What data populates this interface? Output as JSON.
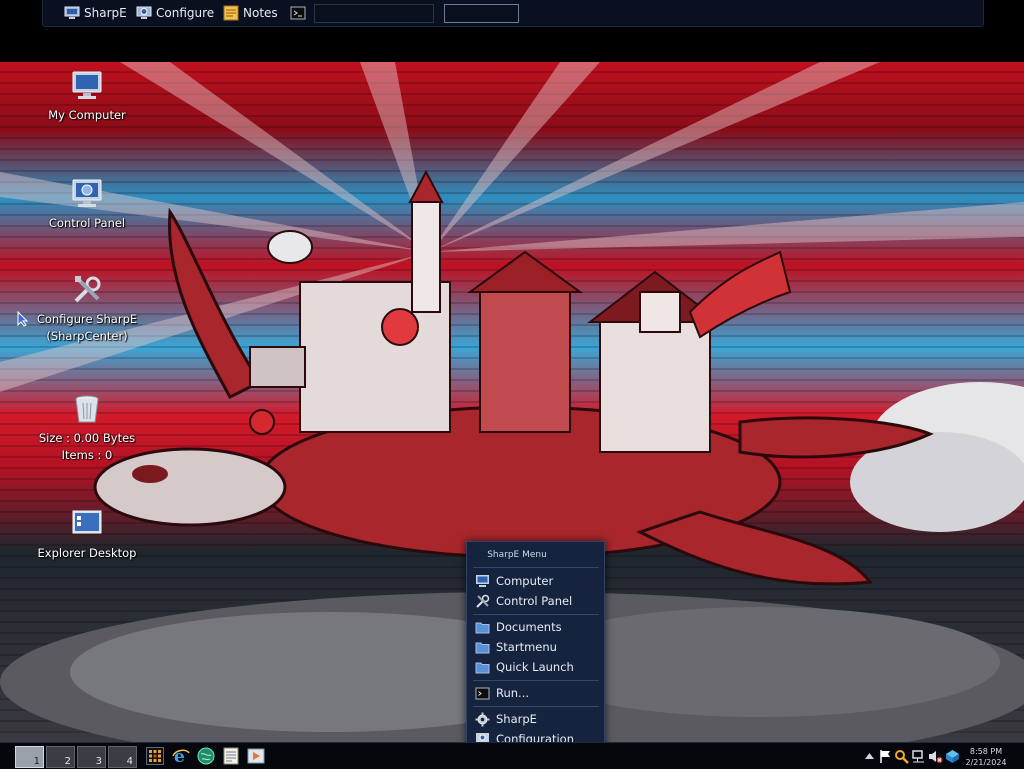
{
  "topbar": {
    "items": [
      {
        "label": "SharpE",
        "icon": "monitor-icon"
      },
      {
        "label": "Configure",
        "icon": "monitor-gear-icon"
      },
      {
        "label": "Notes",
        "icon": "notes-icon"
      },
      {
        "label": "",
        "icon": "terminal-icon"
      }
    ]
  },
  "desktop": {
    "icons": [
      {
        "label": "My Computer",
        "icon": "computer-icon"
      },
      {
        "label": "Control Panel",
        "icon": "control-panel-icon"
      },
      {
        "label_line1": "Configure SharpE",
        "label_line2": "(SharpCenter)",
        "icon": "tools-icon"
      },
      {
        "label_line1": "Size : 0.00 Bytes",
        "label_line2": "Items : 0",
        "icon": "recycle-bin-icon"
      },
      {
        "label": "Explorer Desktop",
        "icon": "explorer-desktop-icon"
      }
    ]
  },
  "menu": {
    "title": "SharpE Menu",
    "items": [
      {
        "label": "Computer",
        "icon": "computer-icon"
      },
      {
        "label": "Control Panel",
        "icon": "tools-icon"
      },
      {
        "label": "Documents",
        "icon": "folder-icon"
      },
      {
        "label": "Startmenu",
        "icon": "folder-icon"
      },
      {
        "label": "Quick Launch",
        "icon": "folder-icon"
      },
      {
        "label": "Run...",
        "icon": "terminal-icon"
      },
      {
        "label": "SharpE",
        "icon": "gear-icon"
      },
      {
        "label": "Configuration",
        "icon": "monitor-gear-icon"
      }
    ]
  },
  "taskbar": {
    "workspaces": [
      "1",
      "2",
      "3",
      "4"
    ],
    "active_workspace": "1",
    "quick_launch": [
      "sharpe-grid-icon",
      "internet-explorer-icon",
      "globe-icon",
      "notepad-icon",
      "media-player-icon"
    ],
    "tray": [
      "arrow-up-icon",
      "flag-icon",
      "search-icon",
      "network-icon",
      "volume-muted-icon",
      "cube-icon"
    ],
    "clock": {
      "time": "8:58 PM",
      "date": "2/21/2024"
    }
  },
  "colors": {
    "menu_bg": "#16233e",
    "taskbar_bg": "#05070d",
    "accent": "#2d8fc0"
  }
}
